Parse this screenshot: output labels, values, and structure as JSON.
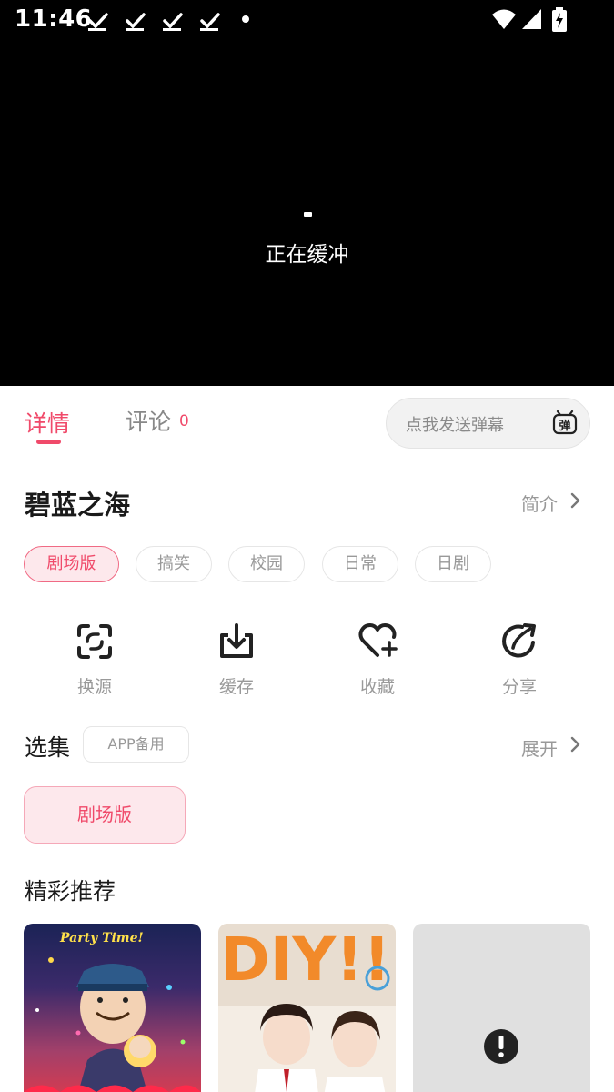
{
  "status_bar": {
    "time": "11:46",
    "download_icons": [
      "download-done-icon",
      "download-done-icon",
      "download-done-icon",
      "download-done-icon"
    ],
    "system_icons": [
      "wifi-icon",
      "signal-icon",
      "battery-charging-icon"
    ]
  },
  "player": {
    "buffer_text": "正在缓冲"
  },
  "tabs": {
    "detail_label": "详情",
    "comments_label": "评论",
    "comments_count": "0",
    "danmaku_placeholder": "点我发送弹幕",
    "danmaku_icon_char": "弹"
  },
  "info": {
    "title": "碧蓝之海",
    "intro_label": "简介"
  },
  "tags": [
    {
      "label": "剧场版",
      "active": true
    },
    {
      "label": "搞笑",
      "active": false
    },
    {
      "label": "校园",
      "active": false
    },
    {
      "label": "日常",
      "active": false
    },
    {
      "label": "日剧",
      "active": false
    }
  ],
  "actions": [
    {
      "label": "换源",
      "icon": "switch-source-icon"
    },
    {
      "label": "缓存",
      "icon": "download-icon"
    },
    {
      "label": "收藏",
      "icon": "heart-plus-icon"
    },
    {
      "label": "分享",
      "icon": "share-icon"
    }
  ],
  "episodes": {
    "title": "选集",
    "badge": "APP备用",
    "expand_label": "展开",
    "items": [
      "剧场版"
    ]
  },
  "recommendations": {
    "title": "精彩推荐",
    "card1_caption": "Party Time!",
    "card2_caption": "DIY!!"
  },
  "colors": {
    "accent": "#f04a6a",
    "accent_light": "#fde8ec",
    "muted_text": "#999999",
    "player_bg": "#000000"
  }
}
